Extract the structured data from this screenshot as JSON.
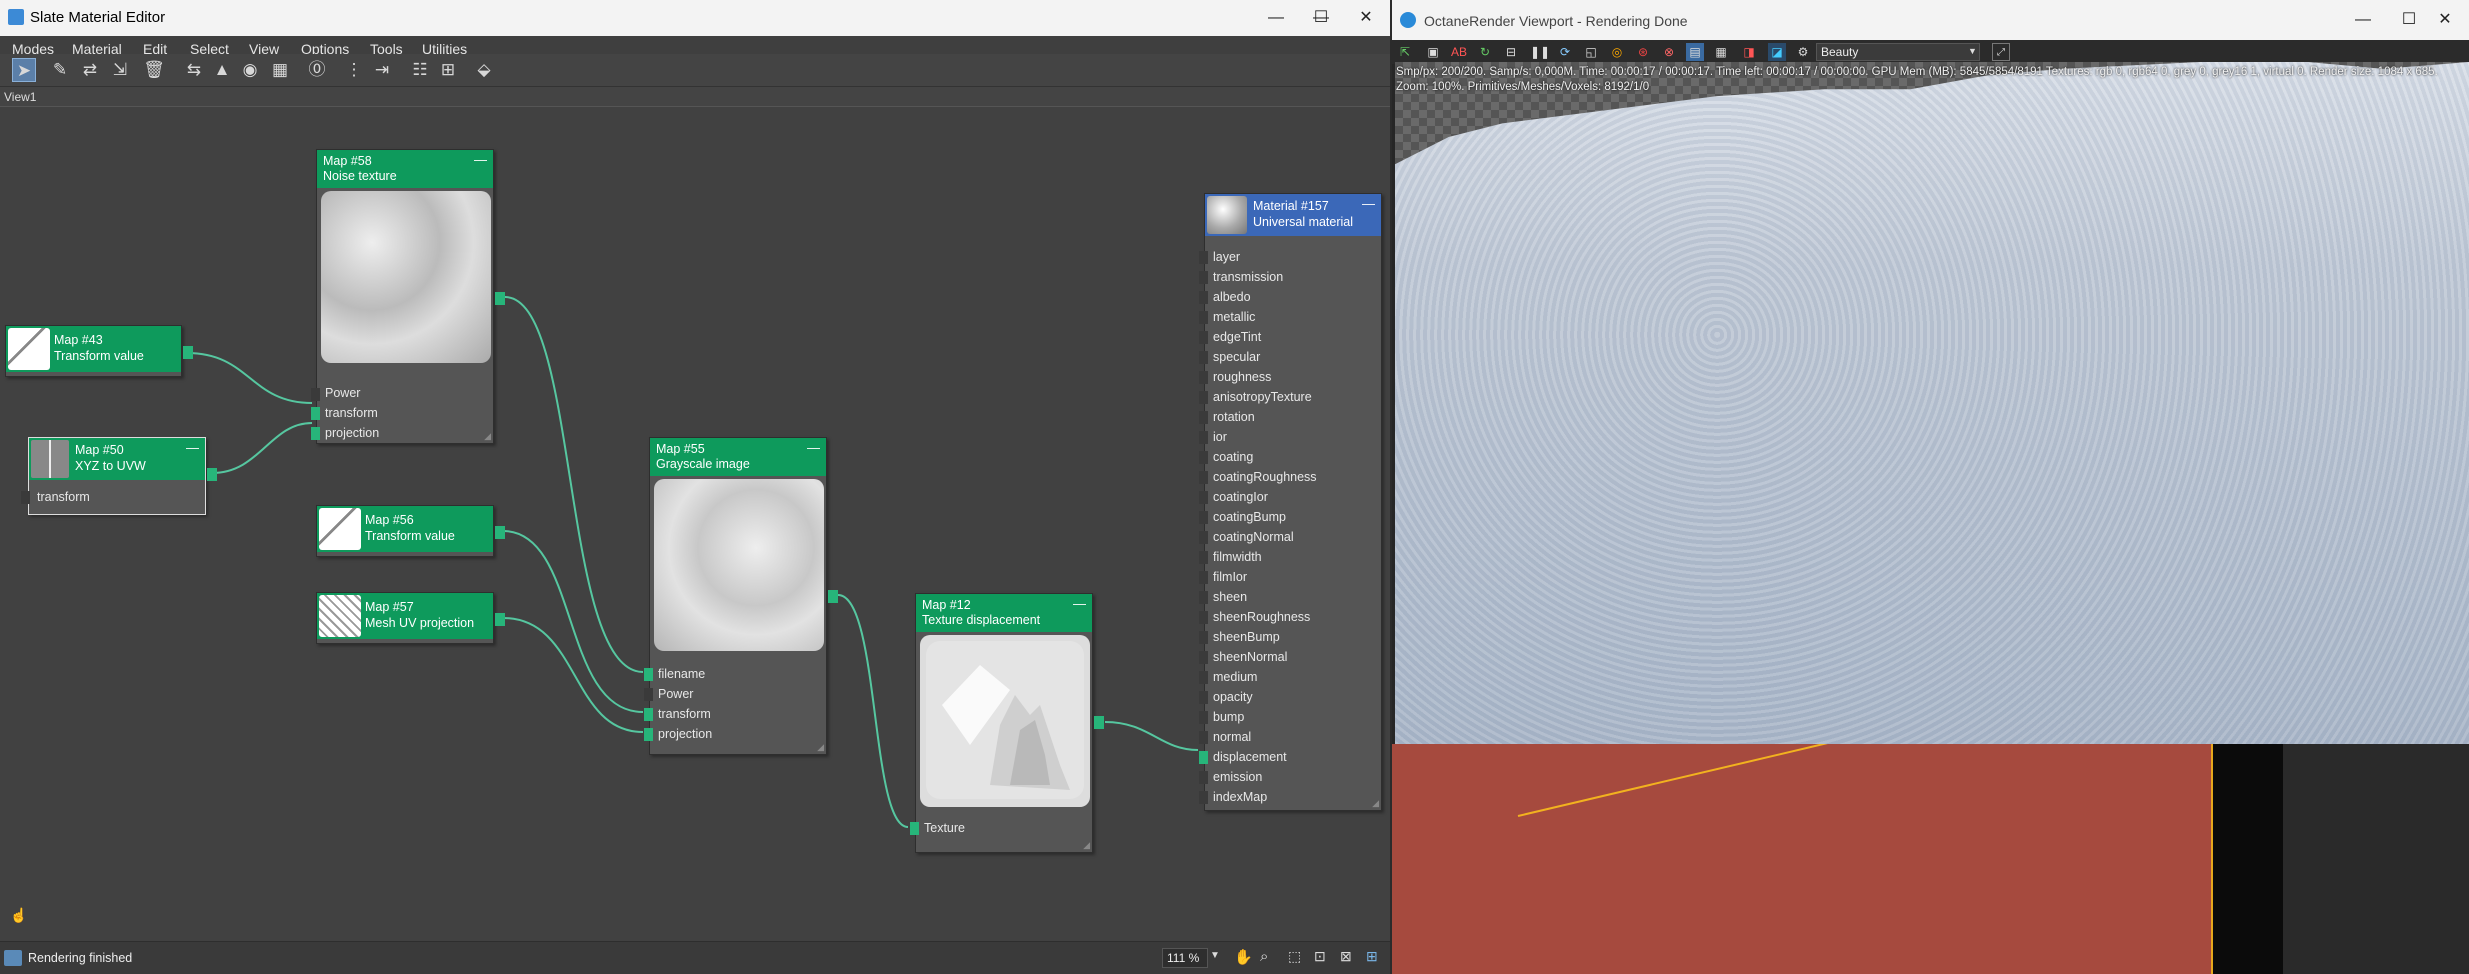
{
  "sme": {
    "title": "Slate Material Editor",
    "menu": [
      "Modes",
      "Material",
      "Edit",
      "Select",
      "View",
      "Options",
      "Tools",
      "Utilities"
    ],
    "view_tab": "View1",
    "status": "Rendering finished",
    "zoom": "111 %",
    "win_min": "—",
    "win_max": "☐",
    "win_close": "✕"
  },
  "nodes": {
    "map58": {
      "title": "Map #58",
      "type": "Noise texture",
      "ports": [
        "Power",
        "transform",
        "projection"
      ]
    },
    "map43": {
      "title": "Map #43",
      "type": "Transform value"
    },
    "map50": {
      "title": "Map #50",
      "type": "XYZ to UVW",
      "ports": [
        "transform"
      ]
    },
    "map56": {
      "title": "Map #56",
      "type": "Transform value"
    },
    "map57": {
      "title": "Map #57",
      "type": "Mesh UV projection"
    },
    "map55": {
      "title": "Map #55",
      "type": "Grayscale image",
      "ports": [
        "filename",
        "Power",
        "transform",
        "projection"
      ]
    },
    "map12": {
      "title": "Map #12",
      "type": "Texture displacement",
      "ports": [
        "Texture"
      ]
    },
    "mat157": {
      "title": "Material #157",
      "type": "Universal material",
      "ports": [
        "layer",
        "transmission",
        "albedo",
        "metallic",
        "edgeTint",
        "specular",
        "roughness",
        "anisotropyTexture",
        "rotation",
        "ior",
        "coating",
        "coatingRoughness",
        "coatingIor",
        "coatingBump",
        "coatingNormal",
        "filmwidth",
        "filmIor",
        "sheen",
        "sheenRoughness",
        "sheenBump",
        "sheenNormal",
        "medium",
        "opacity",
        "bump",
        "normal",
        "displacement",
        "emission",
        "indexMap"
      ]
    }
  },
  "octane": {
    "title": "OctaneRender Viewport - Rendering Done",
    "pass": "Beauty",
    "info_line1": "Smp/px: 200/200.   Samp/s: 0,000M.   Time: 00:00:17 / 00:00:17.   Time left: 00:00:17 / 00:00:00.   GPU Mem (MB): 5845/5854/8191   Textures: rgb 0, rgb64 0, grey 0, grey16 1, virtual 0.   Render size: 1084 x 685.",
    "info_line2": "Zoom: 100%.   Primitives/Meshes/Voxels: 8192/1/0"
  },
  "colors": {
    "node_header": "#0e9a5c",
    "material_header": "#3b68b8",
    "wire": "#56c7a0",
    "floor": "#a64a3e"
  }
}
